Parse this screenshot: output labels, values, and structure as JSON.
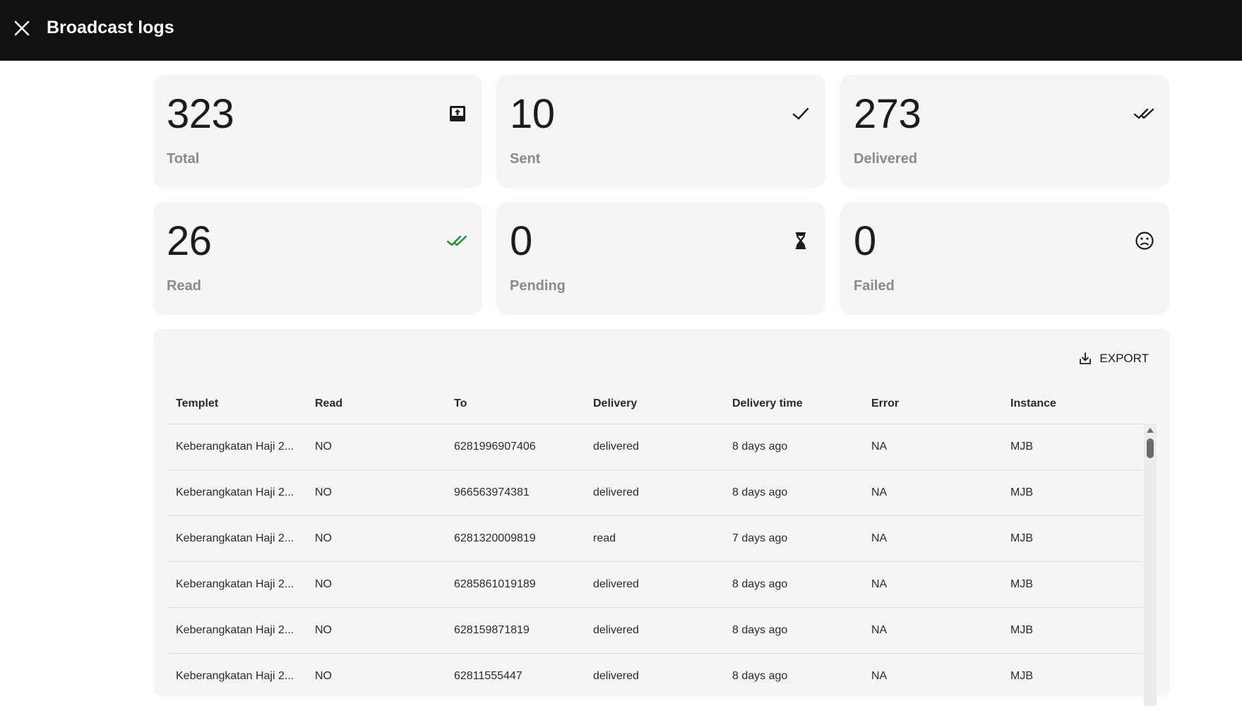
{
  "header": {
    "title": "Broadcast logs"
  },
  "stats": [
    {
      "value": "323",
      "label": "Total",
      "icon": "send-box-icon"
    },
    {
      "value": "10",
      "label": "Sent",
      "icon": "check-icon"
    },
    {
      "value": "273",
      "label": "Delivered",
      "icon": "double-check-icon"
    },
    {
      "value": "26",
      "label": "Read",
      "icon": "double-check-green-icon",
      "color": "#1f8f2f"
    },
    {
      "value": "0",
      "label": "Pending",
      "icon": "hourglass-icon"
    },
    {
      "value": "0",
      "label": "Failed",
      "icon": "sad-face-icon"
    }
  ],
  "export": {
    "label": "EXPORT"
  },
  "table": {
    "columns": [
      "Templet",
      "Read",
      "To",
      "Delivery",
      "Delivery time",
      "Error",
      "Instance"
    ],
    "rows": [
      [
        "Keberangkatan Haji 2...",
        "NO",
        "6281996907406",
        "delivered",
        "8 days ago",
        "NA",
        "MJB"
      ],
      [
        "Keberangkatan Haji 2...",
        "NO",
        "966563974381",
        "delivered",
        "8 days ago",
        "NA",
        "MJB"
      ],
      [
        "Keberangkatan Haji 2...",
        "NO",
        "6281320009819",
        "read",
        "7 days ago",
        "NA",
        "MJB"
      ],
      [
        "Keberangkatan Haji 2...",
        "NO",
        "6285861019189",
        "delivered",
        "8 days ago",
        "NA",
        "MJB"
      ],
      [
        "Keberangkatan Haji 2...",
        "NO",
        "628159871819",
        "delivered",
        "8 days ago",
        "NA",
        "MJB"
      ],
      [
        "Keberangkatan Haji 2...",
        "NO",
        "62811555447",
        "delivered",
        "8 days ago",
        "NA",
        "MJB"
      ]
    ]
  }
}
